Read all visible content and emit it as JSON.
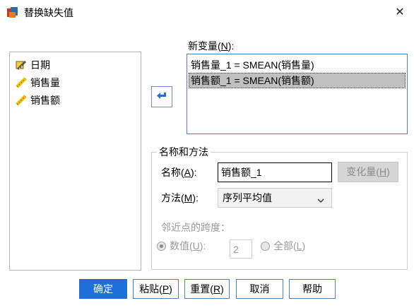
{
  "window": {
    "title": "替换缺失值",
    "app_icon": "spss-dialog-icon",
    "close_icon": "close-icon"
  },
  "source_list": {
    "items": [
      {
        "label": "日期",
        "icon": "ruler-scale-icon"
      },
      {
        "label": "销售量",
        "icon": "ruler-scale-icon"
      },
      {
        "label": "销售额",
        "icon": "ruler-scale-icon"
      }
    ]
  },
  "move_button": {
    "icon": "arrow-left-icon"
  },
  "new_variables": {
    "label_text": "新变量(",
    "label_key": "N",
    "label_tail": "):",
    "rows": [
      {
        "text": "销售量_1 = SMEAN(销售量)",
        "selected": false
      },
      {
        "text": "销售额_1 = SMEAN(销售额)",
        "selected": true
      }
    ]
  },
  "name_method": {
    "group_title": "名称和方法",
    "name_label_text": "名称(",
    "name_label_key": "A",
    "name_label_tail": "):",
    "name_value": "销售额_1",
    "change_button_text": "变化量(",
    "change_button_key": "H",
    "change_button_tail": ")",
    "method_label_text": "方法(",
    "method_label_key": "M",
    "method_label_tail": "):",
    "method_value": "序列平均值",
    "span_label": "邻近点的跨度：",
    "radio_number_text": "数值(",
    "radio_number_key": "U",
    "radio_number_tail": "):",
    "radio_number_selected": true,
    "number_value": "2",
    "radio_all_text": "全部(",
    "radio_all_key": "L",
    "radio_all_tail": ")",
    "radio_all_selected": false
  },
  "buttons": {
    "ok": "确定",
    "paste_text": "粘贴(",
    "paste_key": "P",
    "paste_tail": ")",
    "reset_text": "重置(",
    "reset_key": "R",
    "reset_tail": ")",
    "cancel": "取消",
    "help": "帮助"
  },
  "colors": {
    "primary": "#1e6fd9",
    "focus_border": "#4f81bd",
    "selection": "#c0c0c0",
    "disabled_text": "#9a9a9a"
  }
}
